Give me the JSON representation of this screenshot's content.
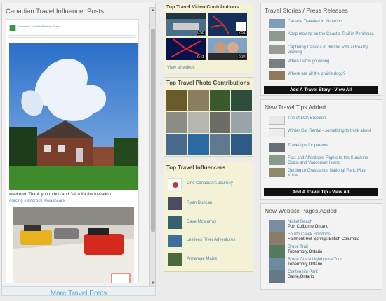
{
  "left": {
    "title": "Canadian Travel Influencer Posts",
    "post_header": "Canadian Travel Influencer Posts",
    "caption": "weekend. Thank you to bud and Jaica for the invitation.",
    "hashtags": "#racing #landrock #iwashcars",
    "more_label": "More Travel Posts"
  },
  "videos": {
    "title": "Top Travel Video Contributions",
    "durations": [
      "0:58",
      "2:51",
      "0:41",
      "0:34"
    ],
    "view_all": "View all videos"
  },
  "photos": {
    "title": "Top Travel Photo Contributions"
  },
  "influencers": {
    "title": "Top Travel Influencers",
    "items": [
      "One Canadian's Journey",
      "Ryan Duncan",
      "Dave McMurray",
      "Lesliees River Adventures",
      "Annamae Maize"
    ]
  },
  "stories": {
    "title": "Travel Stories / Press Releases",
    "items": [
      "Canada Traveled in Waterloo",
      "Keep moving on the Coastal Trail in Peninsula",
      "Capturing Canada in 360 for Virtual Reality viewing",
      "When Dams go wrong",
      "Where are all the prairie dogs?"
    ],
    "button": "Add A Travel Story - View All"
  },
  "tips": {
    "title": "New Travel Tips Added",
    "items": [
      "Trip of 5CK Breeden",
      "Winter Car Rental - something to think about",
      "Travel tips for parents",
      "Fast and Affordable Flights to the Sunshine Coast and Vancouver Island",
      "Getting to Grasslands National Park: Must Know"
    ],
    "button": "Add A Travel Tip - View All"
  },
  "pages": {
    "title": "New Website Pages Added",
    "items": [
      {
        "link": "Nickel Beach",
        "loc": "Port Colborne,Ontario"
      },
      {
        "link": "Fourth Creek Hoodoos",
        "loc": "Fairmont Hot Springs,British Columbia"
      },
      {
        "link": "Bruce Trail",
        "loc": "Tobermory,Ontario"
      },
      {
        "link": "Bruce Coast Lighthouse Tour",
        "loc": "Tobermory,Ontario"
      },
      {
        "link": "Centennial Park",
        "loc": "Barrie,Ontario"
      }
    ]
  }
}
